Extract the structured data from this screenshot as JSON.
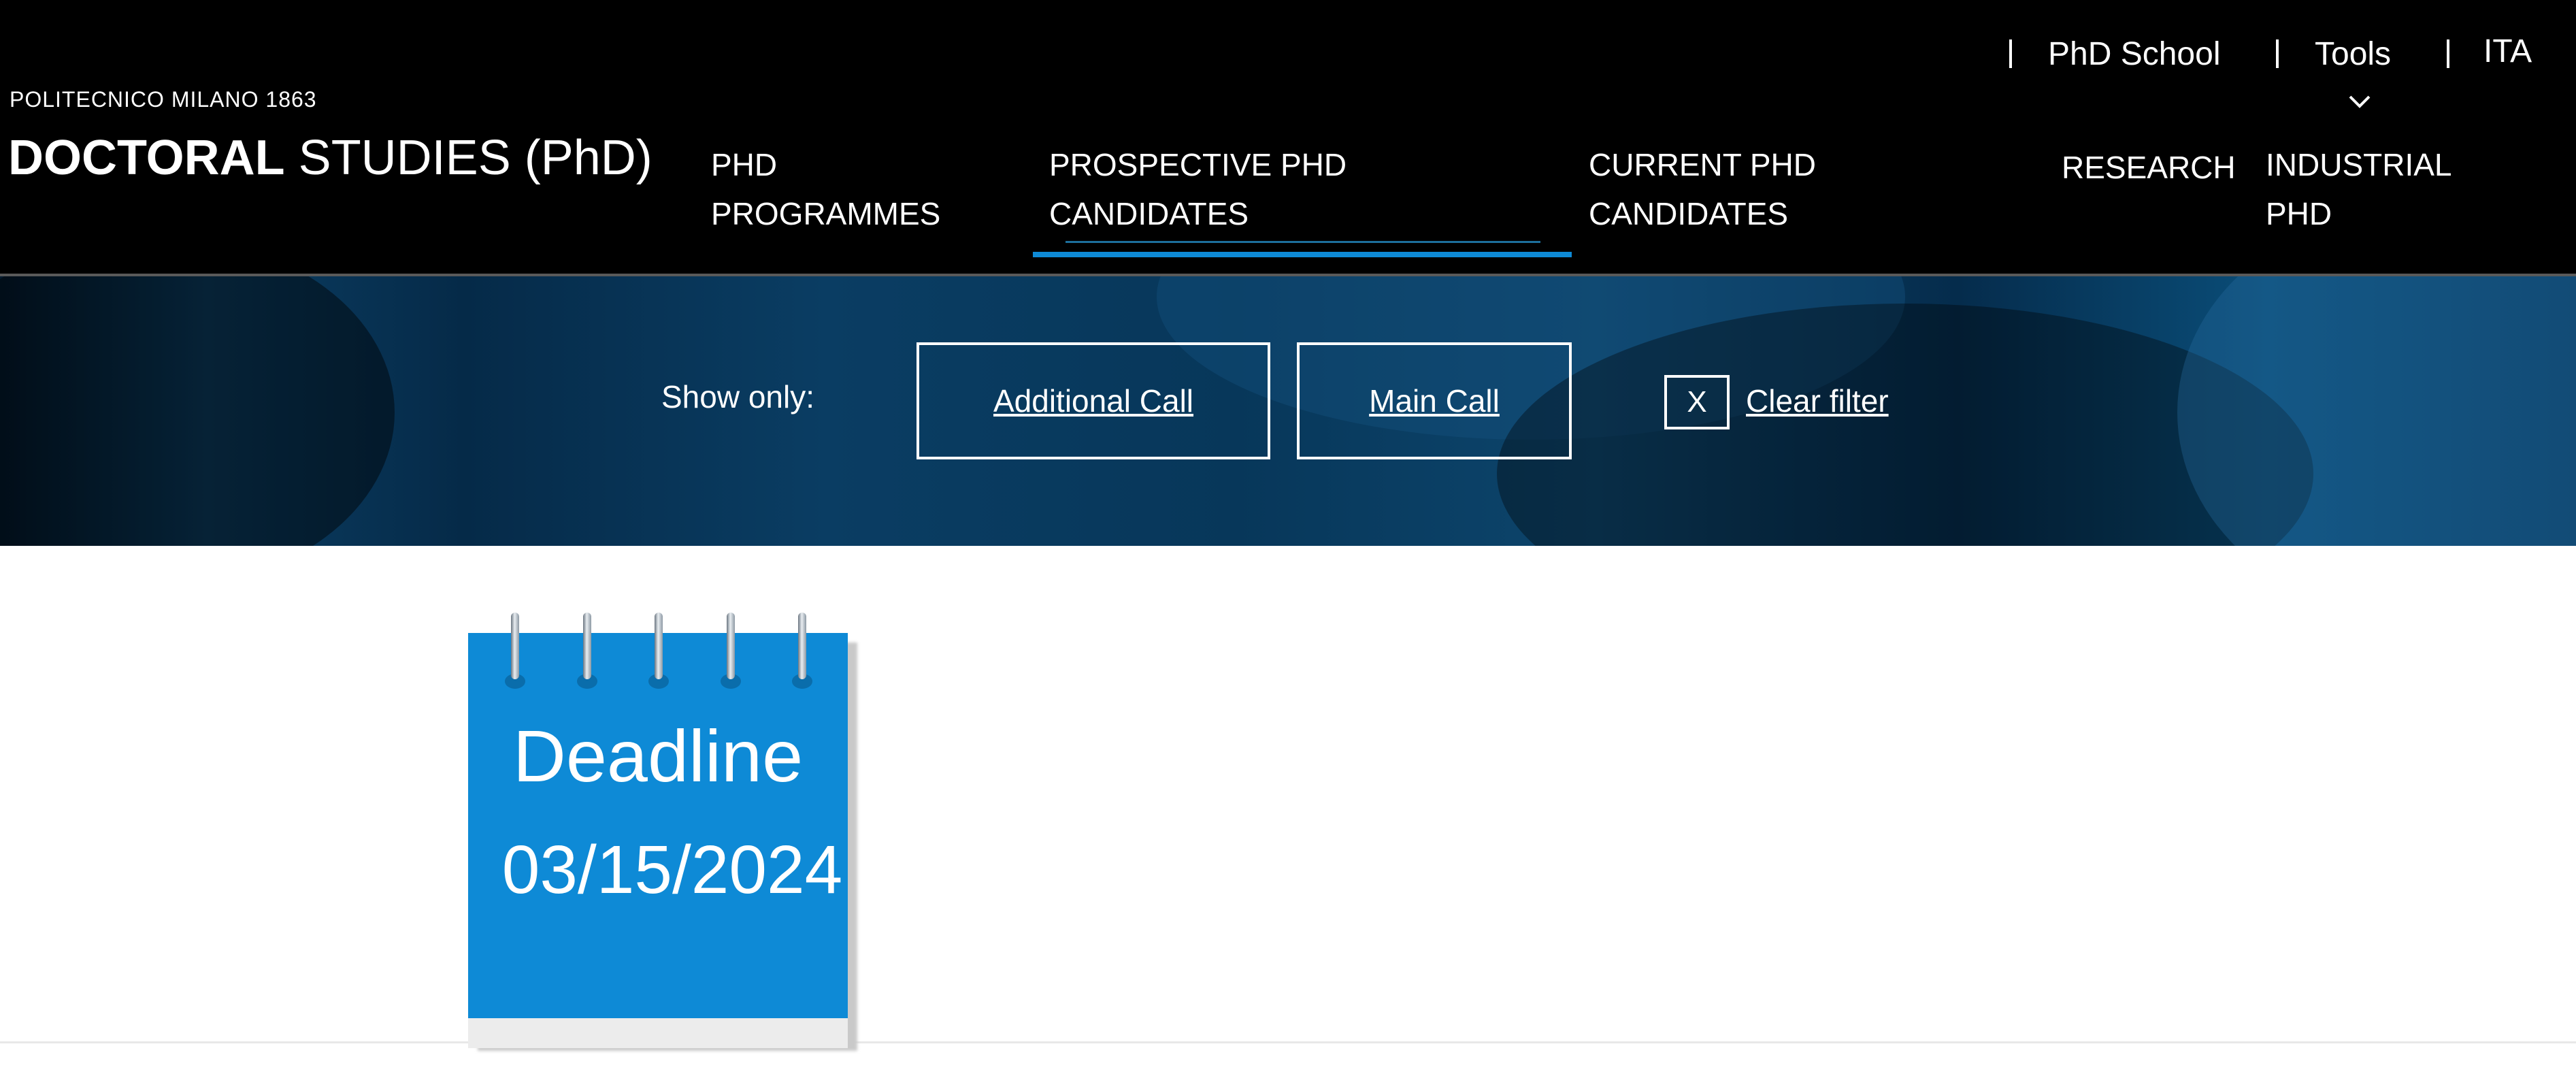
{
  "brand": {
    "institution": "POLITECNICO MILANO 1863",
    "title_strong": "DOCTORAL",
    "title_light": "STUDIES (PhD)"
  },
  "utility_nav": {
    "phd_school": "PhD School",
    "tools": "Tools",
    "language": "ITA"
  },
  "main_nav": [
    {
      "label": "PHD\nPROGRAMMES"
    },
    {
      "label": "PROSPECTIVE PHD\nCANDIDATES",
      "active": true
    },
    {
      "label": "CURRENT PHD\nCANDIDATES"
    },
    {
      "label": "RESEARCH"
    },
    {
      "label": "INDUSTRIAL\nPHD"
    }
  ],
  "filters": {
    "show_only_label": "Show only:",
    "additional_call": "Additional Call",
    "main_call": "Main Call",
    "clear_x": "X",
    "clear_label": "Clear filter"
  },
  "deadline_card": {
    "label": "Deadline",
    "date": "03/15/2024"
  },
  "colors": {
    "accent_blue": "#0e8ad6",
    "header_bg": "#000000"
  }
}
